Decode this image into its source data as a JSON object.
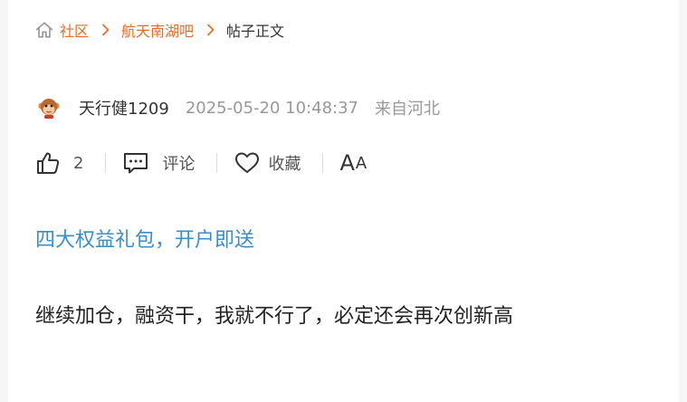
{
  "breadcrumb": {
    "home_icon": "home-icon",
    "items": [
      "社区",
      "航天南湖吧"
    ],
    "current": "帖子正文",
    "link_color": "#e86a24"
  },
  "author": {
    "avatar_icon": "monkey-avatar-icon",
    "name": "天行健1209",
    "time": "2025-05-20 10:48:37",
    "location": "来自河北"
  },
  "actions": {
    "like_icon": "thumbs-up-icon",
    "like_count": "2",
    "comment_icon": "comment-icon",
    "comment_label": "评论",
    "favorite_icon": "heart-icon",
    "favorite_label": "收藏",
    "font_size_large": "A",
    "font_size_small": "A"
  },
  "promo": {
    "text": "四大权益礼包，开户即送",
    "color": "#3a8ec9"
  },
  "post": {
    "content": "继续加仓，融资干，我就不行了，必定还会再次创新高"
  }
}
